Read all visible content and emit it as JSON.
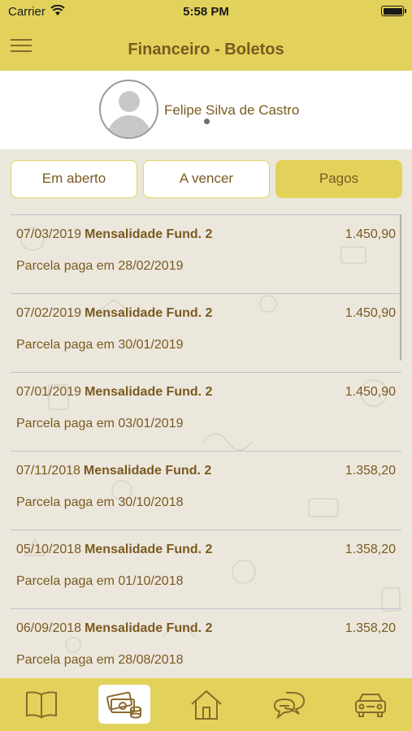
{
  "status_bar": {
    "carrier": "Carrier",
    "time": "5:58 PM"
  },
  "header": {
    "title": "Financeiro - Boletos"
  },
  "profile": {
    "name": "Felipe Silva de Castro"
  },
  "tabs": [
    {
      "label": "Em aberto"
    },
    {
      "label": "A vencer"
    },
    {
      "label": "Pagos",
      "active": true
    }
  ],
  "boletos": [
    {
      "date": "07/03/2019",
      "description": "Mensalidade Fund. 2",
      "amount": "1.450,90",
      "paid_text": "Parcela paga em 28/02/2019"
    },
    {
      "date": "07/02/2019",
      "description": "Mensalidade Fund. 2",
      "amount": "1.450,90",
      "paid_text": "Parcela paga em 30/01/2019"
    },
    {
      "date": "07/01/2019",
      "description": "Mensalidade Fund. 2",
      "amount": "1.450,90",
      "paid_text": "Parcela paga em 03/01/2019"
    },
    {
      "date": "07/11/2018",
      "description": "Mensalidade Fund. 2",
      "amount": "1.358,20",
      "paid_text": "Parcela paga em 30/10/2018"
    },
    {
      "date": "05/10/2018",
      "description": "Mensalidade Fund. 2",
      "amount": "1.358,20",
      "paid_text": "Parcela paga em 01/10/2018"
    },
    {
      "date": "06/09/2018",
      "description": "Mensalidade Fund. 2",
      "amount": "1.358,20",
      "paid_text": "Parcela paga em 28/08/2018"
    }
  ],
  "tab_bar": [
    {
      "icon": "book-icon"
    },
    {
      "icon": "money-icon",
      "active": true
    },
    {
      "icon": "home-icon"
    },
    {
      "icon": "chat-icon"
    },
    {
      "icon": "car-icon"
    }
  ],
  "colors": {
    "accent": "#e2d25c",
    "text": "#7a5a20",
    "background": "#ece7dc"
  }
}
